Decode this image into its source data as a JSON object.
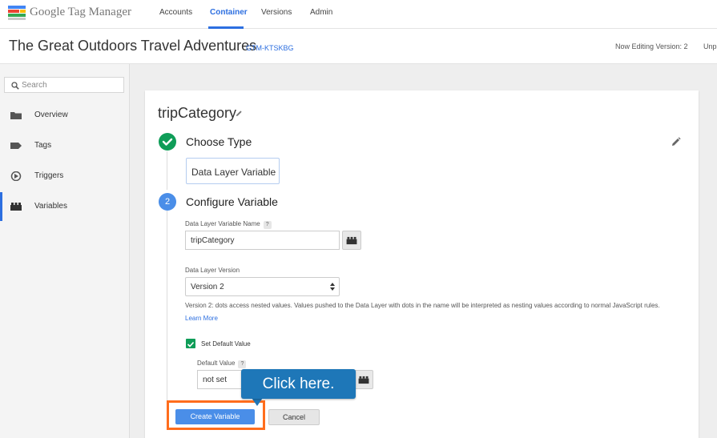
{
  "app": {
    "logo_text": "Google Tag Manager"
  },
  "topnav": {
    "items": [
      {
        "label": "Accounts"
      },
      {
        "label": "Container"
      },
      {
        "label": "Versions"
      },
      {
        "label": "Admin"
      }
    ],
    "active": "Container"
  },
  "header": {
    "container_name": "The Great Outdoors Travel Adventures",
    "container_id": "GTM-KTSKBG",
    "editing_version": "Now Editing Version: 2",
    "truncated_status": "Unp"
  },
  "sidebar": {
    "search_placeholder": "Search",
    "items": [
      {
        "label": "Overview",
        "icon": "folder-icon"
      },
      {
        "label": "Tags",
        "icon": "tag-icon"
      },
      {
        "label": "Triggers",
        "icon": "trigger-icon"
      },
      {
        "label": "Variables",
        "icon": "brick-icon"
      }
    ],
    "active": "Variables"
  },
  "variable": {
    "name": "tripCategory",
    "step1": {
      "number_icon": "check-icon",
      "title": "Choose Type",
      "selected_type": "Data Layer Variable"
    },
    "step2": {
      "number": "2",
      "title": "Configure Variable",
      "dl_name_label": "Data Layer Variable Name",
      "dl_name_value": "tripCategory",
      "dl_version_label": "Data Layer Version",
      "dl_version_value": "Version 2",
      "version_help": "Version 2: dots access nested values. Values pushed to the Data Layer with dots in the name will be interpreted as nesting values according to normal JavaScript rules.",
      "learn_more": "Learn More",
      "set_default_label": "Set Default Value",
      "set_default_checked": true,
      "default_value_label": "Default Value",
      "default_value": "not set",
      "help_symbol": "?"
    },
    "buttons": {
      "create": "Create Variable",
      "cancel": "Cancel"
    }
  },
  "annotation": {
    "callout_text": "Click here.",
    "callout_color": "#1e77b8",
    "highlight_color": "#ff6d1c"
  },
  "colors": {
    "accent": "#2d6fe0",
    "success": "#0f9d58",
    "step_blue": "#4a8ee8"
  }
}
